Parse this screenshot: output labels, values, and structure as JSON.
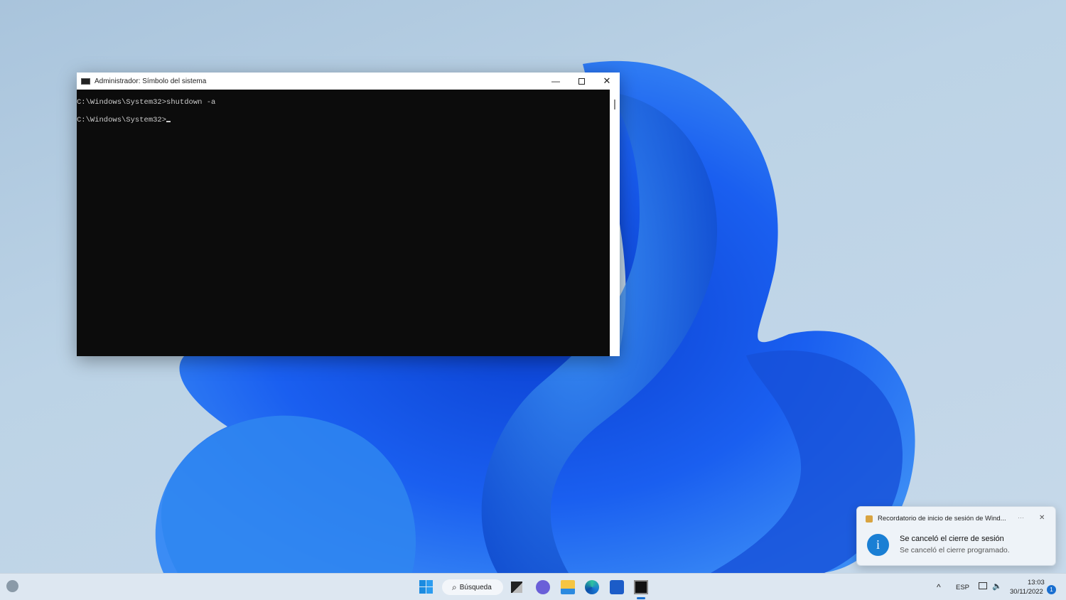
{
  "window": {
    "title": "Administrador: Símbolo del sistema",
    "minimize_icon": "minimize-icon",
    "maximize_icon": "maximize-icon",
    "close_icon": "close-icon",
    "console_lines": [
      "C:\\Windows\\System32>shutdown -a",
      "C:\\Windows\\System32>"
    ]
  },
  "notification": {
    "app": "Recordatorio de inicio de sesión de Wind...",
    "more": "···",
    "close": "✕",
    "title": "Se canceló el cierre de sesión",
    "body": "Se canceló el cierre programado.",
    "accent": "#1a7fd4"
  },
  "taskbar": {
    "search_label": "Búsqueda",
    "apps": [
      "start",
      "search",
      "task-view",
      "teams-chat",
      "file-explorer",
      "edge",
      "store",
      "terminal"
    ],
    "tray": {
      "chevron": "^",
      "language": "ESP",
      "time": "13:03",
      "date": "30/11/2022"
    }
  }
}
